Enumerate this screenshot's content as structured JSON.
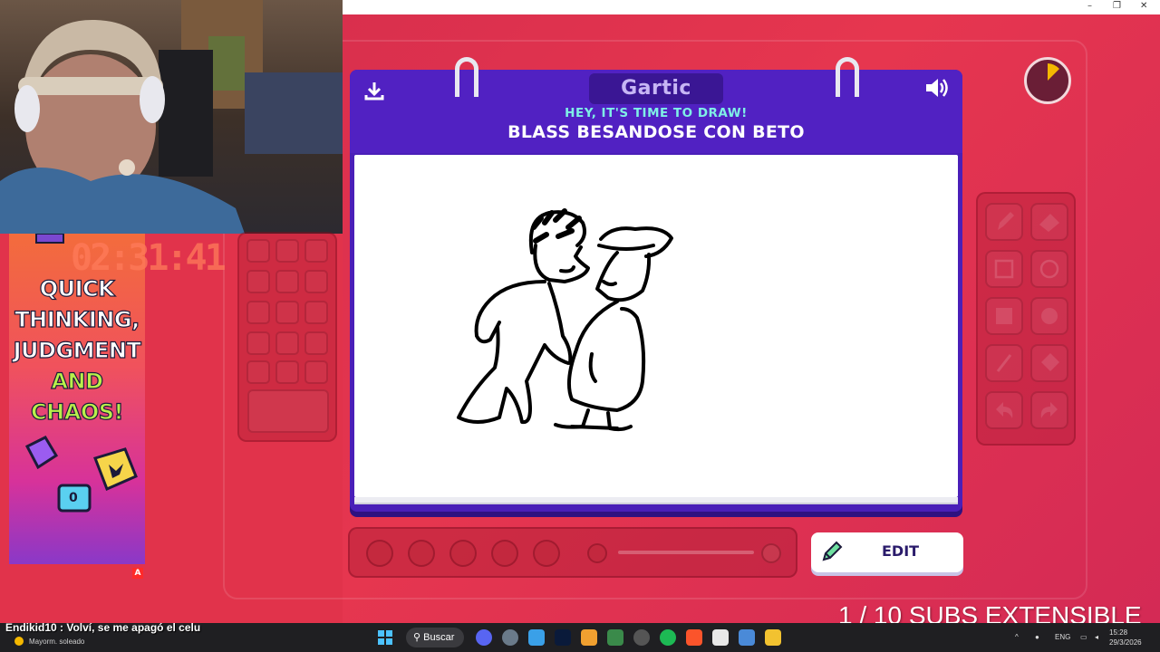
{
  "window": {
    "minimize": "–",
    "maximize": "❐",
    "close": "✕"
  },
  "promo": {
    "line1": "QUICK",
    "line2": "THINKING,",
    "line3": "JUDGMENT",
    "line4": "AND",
    "line5": "CHAOS!",
    "timer": "02:31:41",
    "badge": "A",
    "dice_value": "0"
  },
  "game": {
    "logo": "Gartic",
    "prompt_sub": "HEY, IT'S TIME TO DRAW!",
    "prompt_main": "BLASS BESANDOSE CON BETO",
    "edit_label": "EDIT",
    "accent": "#4a1fb8",
    "cyan": "#7ff0e6"
  },
  "overlay": {
    "subs": "1 / 10 SUBS EXTENSIBLE"
  },
  "taskbar": {
    "chat": "Endikid10 : Volví, se me apagó el celu",
    "weather": "Mayorm. soleado",
    "search": "Buscar",
    "lang": "ENG",
    "time": "15:28",
    "date": "29/3/2026"
  }
}
